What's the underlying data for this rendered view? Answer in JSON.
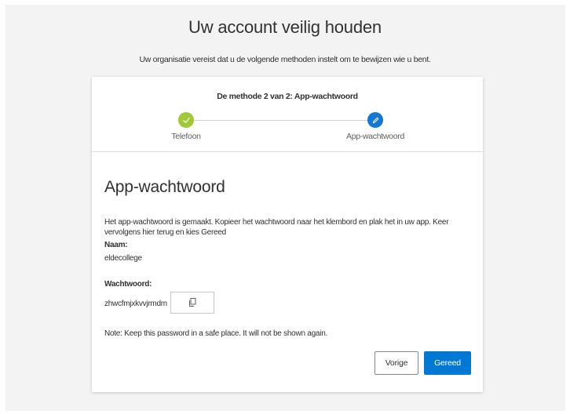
{
  "page": {
    "title": "Uw account veilig houden",
    "subtitle": "Uw organisatie vereist dat u de volgende methoden instelt om te bewijzen wie u bent."
  },
  "stepper": {
    "title": "De methode 2 van 2: App-wachtwoord",
    "steps": [
      {
        "label": "Telefoon",
        "state": "completed",
        "icon": "checkmark-icon",
        "color": "#9fc937"
      },
      {
        "label": "App-wachtwoord",
        "state": "current",
        "icon": "pencil-icon",
        "color": "#1378d5"
      }
    ]
  },
  "content": {
    "heading": "App-wachtwoord",
    "description": "Het app-wachtwoord is gemaakt. Kopieer het wachtwoord naar het klembord en plak het in uw app. Keer vervolgens hier terug en kies Gereed",
    "name_label": "Naam:",
    "name_value": "eldecollege",
    "password_label": "Wachtwoord:",
    "password_value": "zhwcfmjxkvvjrmdm",
    "copy_icon": "copy-icon",
    "note": "Note: Keep this password in a safe place. It will not be shown again."
  },
  "actions": {
    "back_label": "Vorige",
    "done_label": "Gereed",
    "primary_color": "#0078d4"
  }
}
